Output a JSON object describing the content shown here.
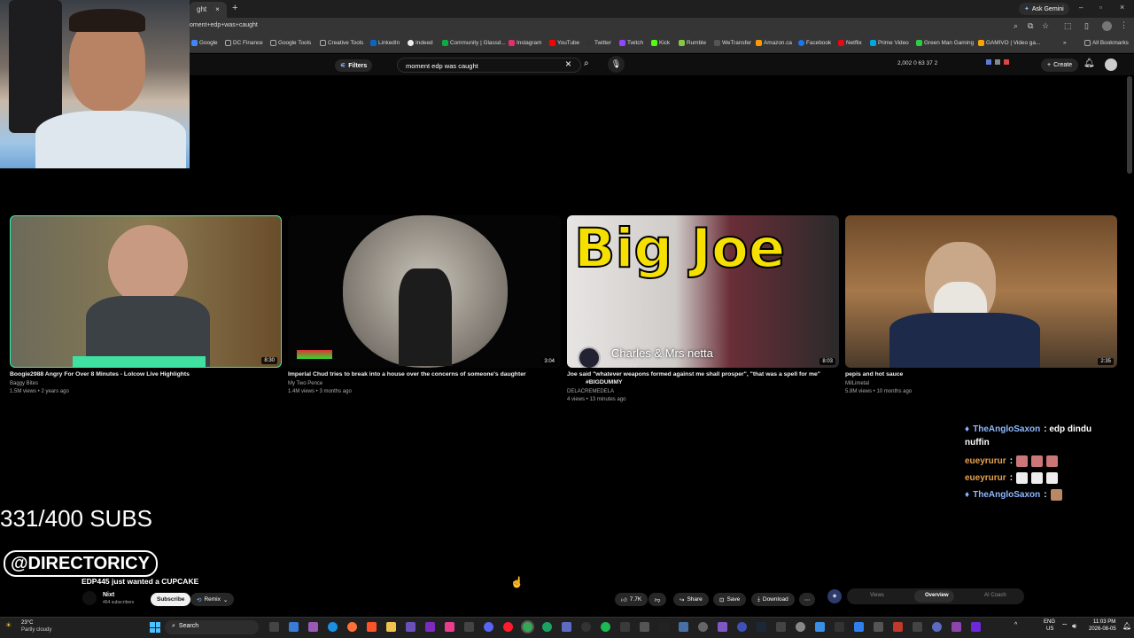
{
  "browser": {
    "tab_title": "ght",
    "url": "oment+edp+was+caught",
    "gemini": "Ask Gemini",
    "bookmarks": [
      "Google",
      "DC Finance",
      "Google Tools",
      "Creative Tools",
      "LinkedIn",
      "Indeed",
      "Community | Glassd...",
      "Instagram",
      "YouTube",
      "Twitter",
      "Twitch",
      "Kick",
      "Rumble",
      "WeTransfer",
      "Amazon.ca",
      "Facebook",
      "Netflix",
      "Prime Video",
      "Green Man Gaming",
      "GAMIVO | Video ga..."
    ],
    "all_bookmarks": "All Bookmarks"
  },
  "youtube": {
    "filters": "Filters",
    "search_value": "moment edp was caught",
    "stats": "2,002  0  63  37  2",
    "create": "Create"
  },
  "videos": [
    {
      "title": "Boogie2988 Angry For Over 8 Minutes - Lolcow Live Highlights",
      "channel": "Baggy Bites",
      "meta": "1.5M views • 2 years ago",
      "duration": "8:30"
    },
    {
      "title": "Imperial Chud tries to break into a house over the concerns of someone's daughter",
      "channel": "My Two Pence",
      "meta": "1.4M views • 3 months ago",
      "duration": "3:04"
    },
    {
      "title": "Joe said \"whatever weapons formed against me shall prosper\", \"that was a spell for me\"",
      "title2": "#BIGDUMMY",
      "channel": "DELACREMEDELA",
      "meta": "4 views • 13 minutes ago",
      "duration": "8:03",
      "overlay_title": "Big Joe",
      "overlay_caption": "Charles & Mrs netta",
      "overlay_sub": "Today"
    },
    {
      "title": "pepis and hot sauce",
      "channel": "MilLimetal",
      "meta": "5.8M views • 10 months ago",
      "duration": "2:35"
    }
  ],
  "overlay": {
    "subs": "331/400 SUBS",
    "handle": "@DIRECTORICY"
  },
  "chat": [
    {
      "user": "TheAngloSaxon",
      "text": ": edp dindu",
      "text2": "nuffin",
      "color": "#8fb8ff"
    },
    {
      "user": "eueyrurur",
      "text": ":",
      "color": "#e6a050"
    },
    {
      "user": "eueyrurur",
      "text": ":",
      "color": "#e6a050"
    },
    {
      "user": "TheAngloSaxon",
      "text": ":",
      "color": "#8fb8ff"
    }
  ],
  "player": {
    "title": "EDP445 just wanted a CUPCAKE",
    "channel": "Nixt",
    "subscribers": "464 subscribers",
    "subscribe": "Subscribe",
    "remix": "Remix",
    "likes": "7.7K",
    "share": "Share",
    "save": "Save",
    "download": "Download",
    "tabs": [
      "Views",
      "Overview",
      "AI Coach"
    ]
  },
  "taskbar": {
    "weather_temp": "23°C",
    "weather_desc": "Partly cloudy",
    "search": "Search",
    "lang": "ENG",
    "region": "US",
    "time": "11:03 PM",
    "date": "2026-08-05"
  }
}
